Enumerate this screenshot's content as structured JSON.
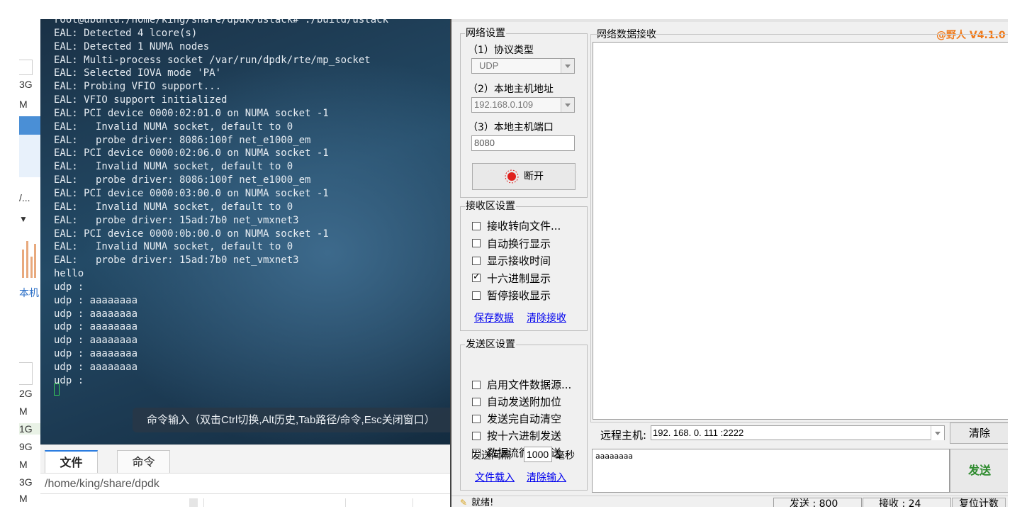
{
  "left_strip": {
    "labels": [
      "3G",
      "M",
      "/...",
      "本机",
      "2G",
      "M",
      "1G",
      "9G",
      "M",
      "3G",
      "M"
    ]
  },
  "terminal": {
    "lines": [
      "root@ubuntu:/home/king/share/dpdk/ustack# ./build/ustack",
      "EAL: Detected 4 lcore(s)",
      "EAL: Detected 1 NUMA nodes",
      "EAL: Multi-process socket /var/run/dpdk/rte/mp_socket",
      "EAL: Selected IOVA mode 'PA'",
      "EAL: Probing VFIO support...",
      "EAL: VFIO support initialized",
      "EAL: PCI device 0000:02:01.0 on NUMA socket -1",
      "EAL:   Invalid NUMA socket, default to 0",
      "EAL:   probe driver: 8086:100f net_e1000_em",
      "EAL: PCI device 0000:02:06.0 on NUMA socket -1",
      "EAL:   Invalid NUMA socket, default to 0",
      "EAL:   probe driver: 8086:100f net_e1000_em",
      "EAL: PCI device 0000:03:00.0 on NUMA socket -1",
      "EAL:   Invalid NUMA socket, default to 0",
      "EAL:   probe driver: 15ad:7b0 net_vmxnet3",
      "EAL: PCI device 0000:0b:00.0 on NUMA socket -1",
      "EAL:   Invalid NUMA socket, default to 0",
      "EAL:   probe driver: 15ad:7b0 net_vmxnet3",
      "hello",
      "udp :",
      "udp : aaaaaaaa",
      "udp : aaaaaaaa",
      "udp : aaaaaaaa",
      "udp : aaaaaaaa",
      "udp : aaaaaaaa",
      "udp : aaaaaaaa",
      "udp :"
    ],
    "command_hint": "命令输入（双击Ctrl切换,Alt历史,Tab路径/命令,Esc关闭窗口）"
  },
  "tabs": [
    {
      "label": "文件",
      "active": true
    },
    {
      "label": "命令",
      "active": false
    }
  ],
  "path": "/home/king/share/dpdk",
  "net_assistant": {
    "version": "@野人 V4.1.0",
    "network_settings": {
      "title": "网络设置",
      "protocol_label": "（1）协议类型",
      "protocol_value": "UDP",
      "local_ip_label": "（2）本地主机地址",
      "local_ip_value": "192.168.0.109",
      "local_port_label": "（3）本地主机端口",
      "local_port_value": "8080",
      "disconnect_label": "断开"
    },
    "receive_settings": {
      "title": "接收区设置",
      "options": [
        {
          "label": "接收转向文件...",
          "checked": false
        },
        {
          "label": "自动换行显示",
          "checked": false
        },
        {
          "label": "显示接收时间",
          "checked": false
        },
        {
          "label": "十六进制显示",
          "checked": true
        },
        {
          "label": "暂停接收显示",
          "checked": false
        }
      ],
      "save_link": "保存数据",
      "clear_link": "清除接收"
    },
    "send_settings": {
      "title": "发送区设置",
      "options": [
        {
          "label": "启用文件数据源...",
          "checked": false
        },
        {
          "label": "自动发送附加位",
          "checked": false
        },
        {
          "label": "发送完自动清空",
          "checked": false
        },
        {
          "label": "按十六进制发送",
          "checked": false
        },
        {
          "label": "数据流循环发送",
          "checked": false
        }
      ],
      "interval_label": "发送间隔",
      "interval_value": "1000",
      "interval_unit": "毫秒",
      "load_file_link": "文件载入",
      "clear_input_link": "清除输入"
    },
    "receive_area_title": "网络数据接收",
    "remote_host_label": "远程主机:",
    "remote_host_value": "192. 168. 0. 111  :2222",
    "clear_button": "清除",
    "send_button": "发送",
    "send_text": "aaaaaaaa",
    "status": {
      "ready": "就绪!",
      "sent": "发送 : 800",
      "received": "接收 : 24",
      "reset": "复位计数"
    },
    "colors": {
      "version": "#f07a1a",
      "send_button_text": "#2e8b2e",
      "link": "#0000ee",
      "disconnect_indicator": "#e0201c"
    }
  }
}
